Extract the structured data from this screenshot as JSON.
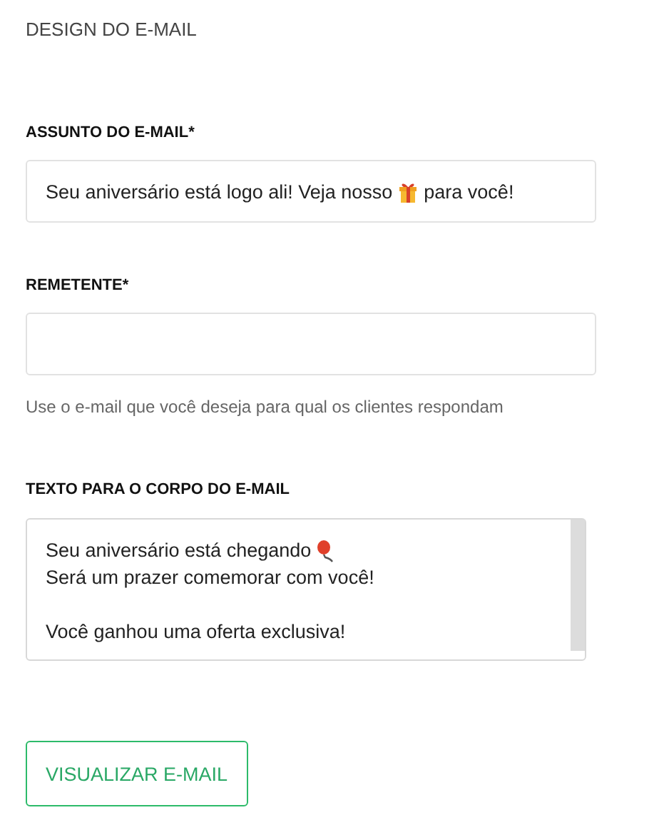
{
  "section_title": "DESIGN DO E-MAIL",
  "subject": {
    "label": "ASSUNTO DO E-MAIL*",
    "text_before": "Seu aniversário está logo ali! Veja nosso",
    "text_after": "para você!"
  },
  "sender": {
    "label": "REMETENTE*",
    "hint": "Use o e-mail que você deseja para qual os clientes respondam"
  },
  "body": {
    "label": "TEXTO PARA O CORPO DO E-MAIL",
    "paragraphs": [
      {
        "lines": [
          "Seu aniversário está chegando",
          "Será um prazer comemorar com você!"
        ]
      },
      {
        "lines": [
          "Você ganhou uma oferta exclusiva!"
        ]
      }
    ]
  },
  "preview_button": "VISUALIZAR E-MAIL"
}
